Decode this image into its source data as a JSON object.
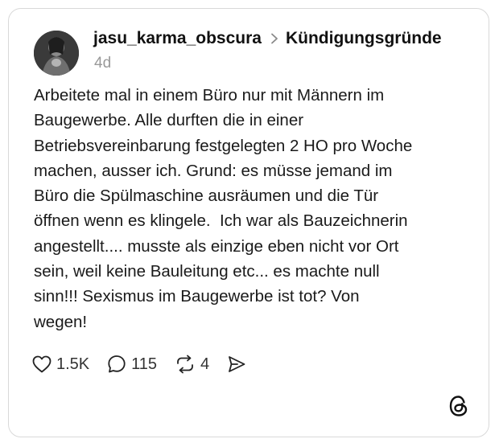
{
  "post": {
    "username": "jasu_karma_obscura",
    "topic": "Kündigungsgründe",
    "timestamp": "4d",
    "body": "Arbeitete mal in einem Büro nur mit Männern im\nBaugewerbe. Alle durften die in einer\nBetriebsvereinbarung festgelegten 2 HO pro Woche\nmachen, ausser ich. Grund: es müsse jemand im\nBüro die Spülmaschine ausräumen und die Tür\nöffnen wenn es klingele.  Ich war als Bauzeichnerin\nangestellt.... musste als einzige eben nicht vor Ort\nsein, weil keine Bauleitung etc... es machte null\nsinn!!! Sexismus im Baugewerbe ist tot? Von\nwegen!"
  },
  "actions": {
    "likes": "1.5K",
    "replies": "115",
    "reposts": "4"
  },
  "icons": {
    "like": "heart-icon",
    "reply": "speech-bubble-icon",
    "repost": "repost-arrows-icon",
    "share": "send-icon",
    "brand": "threads-logo-icon"
  },
  "colors": {
    "text": "#111111",
    "muted": "#999999",
    "border": "#d9d9d9"
  }
}
